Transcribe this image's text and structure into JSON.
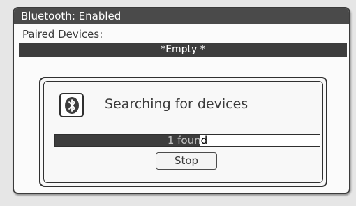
{
  "header": {
    "title": "Bluetooth: Enabled"
  },
  "paired": {
    "label": "Paired Devices:",
    "items": [
      "*Empty *"
    ]
  },
  "search_dialog": {
    "icon": "bluetooth-icon",
    "message": "Searching for devices",
    "progress_text": "1 found",
    "progress_fraction": 0.55,
    "stop_label": "Stop"
  },
  "colors": {
    "dark": "#3d3d3d",
    "light": "#fbfbfb",
    "text": "#3a3a3a"
  }
}
